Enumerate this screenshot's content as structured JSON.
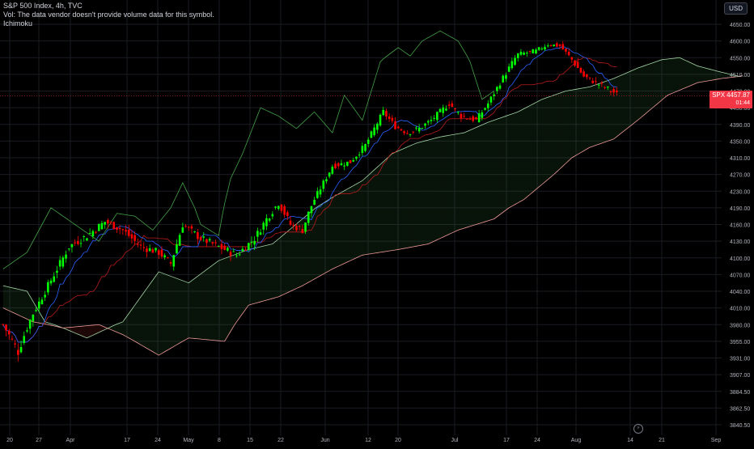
{
  "header": {
    "title": "S&P 500 Index, 4h, TVC",
    "vol_note": "Vol: The data vendor doesn't provide volume data for this symbol.",
    "indicator": "Ichimoku"
  },
  "currency": "USD",
  "price_badge": {
    "symbol": "SPX",
    "value": "4457.87",
    "countdown": "01:44"
  },
  "colors": {
    "background": "#000000",
    "grid": "#1a1c22",
    "up": "#00ff00",
    "down": "#ff0000",
    "conversion_line": "#2962ff",
    "base_line": "#b71c1c",
    "lagging_span": "#43a047",
    "lead_a": "#a5d6a7",
    "lead_b": "#ef9a9a",
    "cloud_bull": "rgba(67,160,71,0.12)",
    "cloud_bear": "rgba(244,67,54,0.12)",
    "price_line": "#f23645",
    "axis_text": "#b2b5be"
  },
  "chart_data": {
    "type": "candlestick",
    "symbol": "S&P 500 Index",
    "interval": "4h",
    "source": "TVC",
    "indicator": "Ichimoku",
    "y_ticks": [
      3840.5,
      3862.5,
      3884.5,
      3907.0,
      3931.0,
      3955.0,
      3980.0,
      4010.0,
      4040.0,
      4070.0,
      4100.0,
      4130.0,
      4160.0,
      4190.0,
      4230.0,
      4270.0,
      4310.0,
      4350.0,
      4390.0,
      4430.0,
      4470.0,
      4510.0,
      4550.0,
      4600.0,
      4650.0
    ],
    "y_tick_labels": [
      "3840.50",
      "3862.50",
      "3884.50",
      "3907.00",
      "3931.00",
      "3955.00",
      "3980.00",
      "4010.00",
      "4040.00",
      "4070.00",
      "4100.00",
      "4130.00",
      "4160.00",
      "4190.00",
      "4230.00",
      "4270.00",
      "4310.00",
      "4350.00",
      "4390.00",
      "4430.00",
      "4470.00",
      "4510.00",
      "4550.00",
      "4600.00",
      "4650.00"
    ],
    "x_ticks": [
      "20",
      "27",
      "Apr",
      "17",
      "24",
      "May",
      "8",
      "15",
      "22",
      "Jun",
      "12",
      "20",
      "Jul",
      "17",
      "24",
      "Aug",
      "14",
      "21",
      "Sep"
    ],
    "last_price": 4457.87,
    "anchors": [
      {
        "i": 0,
        "p": 3980
      },
      {
        "i": 5,
        "p": 3940
      },
      {
        "i": 10,
        "p": 4000
      },
      {
        "i": 16,
        "p": 4060
      },
      {
        "i": 22,
        "p": 4120
      },
      {
        "i": 28,
        "p": 4140
      },
      {
        "i": 34,
        "p": 4165
      },
      {
        "i": 40,
        "p": 4150
      },
      {
        "i": 46,
        "p": 4120
      },
      {
        "i": 52,
        "p": 4110
      },
      {
        "i": 56,
        "p": 4090
      },
      {
        "i": 60,
        "p": 4160
      },
      {
        "i": 66,
        "p": 4135
      },
      {
        "i": 72,
        "p": 4120
      },
      {
        "i": 78,
        "p": 4105
      },
      {
        "i": 84,
        "p": 4135
      },
      {
        "i": 88,
        "p": 4170
      },
      {
        "i": 92,
        "p": 4200
      },
      {
        "i": 96,
        "p": 4160
      },
      {
        "i": 100,
        "p": 4150
      },
      {
        "i": 104,
        "p": 4210
      },
      {
        "i": 110,
        "p": 4290
      },
      {
        "i": 116,
        "p": 4300
      },
      {
        "i": 121,
        "p": 4340
      },
      {
        "i": 127,
        "p": 4420
      },
      {
        "i": 131,
        "p": 4385
      },
      {
        "i": 135,
        "p": 4370
      },
      {
        "i": 139,
        "p": 4380
      },
      {
        "i": 143,
        "p": 4400
      },
      {
        "i": 149,
        "p": 4440
      },
      {
        "i": 153,
        "p": 4410
      },
      {
        "i": 158,
        "p": 4400
      },
      {
        "i": 162,
        "p": 4440
      },
      {
        "i": 166,
        "p": 4490
      },
      {
        "i": 172,
        "p": 4560
      },
      {
        "i": 178,
        "p": 4570
      },
      {
        "i": 182,
        "p": 4590
      },
      {
        "i": 186,
        "p": 4585
      },
      {
        "i": 189,
        "p": 4555
      },
      {
        "i": 194,
        "p": 4505
      },
      {
        "i": 198,
        "p": 4490
      },
      {
        "i": 202,
        "p": 4475
      },
      {
        "i": 206,
        "p": 4458
      }
    ],
    "lag_anchors": [
      {
        "i": 0,
        "p": 4080
      },
      {
        "i": 8,
        "p": 4110
      },
      {
        "i": 16,
        "p": 4190
      },
      {
        "i": 24,
        "p": 4160
      },
      {
        "i": 32,
        "p": 4130
      },
      {
        "i": 38,
        "p": 4180
      },
      {
        "i": 44,
        "p": 4175
      },
      {
        "i": 50,
        "p": 4150
      },
      {
        "i": 56,
        "p": 4190
      },
      {
        "i": 60,
        "p": 4250
      },
      {
        "i": 66,
        "p": 4160
      },
      {
        "i": 72,
        "p": 4140
      },
      {
        "i": 76,
        "p": 4260
      },
      {
        "i": 80,
        "p": 4320
      },
      {
        "i": 86,
        "p": 4430
      },
      {
        "i": 92,
        "p": 4410
      },
      {
        "i": 98,
        "p": 4380
      },
      {
        "i": 104,
        "p": 4420
      },
      {
        "i": 110,
        "p": 4370
      },
      {
        "i": 114,
        "p": 4460
      },
      {
        "i": 120,
        "p": 4400
      },
      {
        "i": 126,
        "p": 4540
      },
      {
        "i": 132,
        "p": 4580
      },
      {
        "i": 136,
        "p": 4555
      },
      {
        "i": 140,
        "p": 4600
      },
      {
        "i": 146,
        "p": 4630
      },
      {
        "i": 152,
        "p": 4600
      },
      {
        "i": 156,
        "p": 4540
      },
      {
        "i": 160,
        "p": 4450
      },
      {
        "i": 164,
        "p": 4470
      }
    ],
    "spanA_anchors": [
      {
        "i": 0,
        "p": 4050
      },
      {
        "i": 8,
        "p": 4040
      },
      {
        "i": 14,
        "p": 3985
      },
      {
        "i": 20,
        "p": 3975
      },
      {
        "i": 28,
        "p": 3960
      },
      {
        "i": 40,
        "p": 3985
      },
      {
        "i": 52,
        "p": 4075
      },
      {
        "i": 62,
        "p": 4055
      },
      {
        "i": 72,
        "p": 4095
      },
      {
        "i": 82,
        "p": 4115
      },
      {
        "i": 90,
        "p": 4125
      },
      {
        "i": 100,
        "p": 4170
      },
      {
        "i": 110,
        "p": 4215
      },
      {
        "i": 120,
        "p": 4255
      },
      {
        "i": 130,
        "p": 4320
      },
      {
        "i": 138,
        "p": 4345
      },
      {
        "i": 146,
        "p": 4360
      },
      {
        "i": 154,
        "p": 4370
      },
      {
        "i": 162,
        "p": 4395
      },
      {
        "i": 172,
        "p": 4420
      },
      {
        "i": 180,
        "p": 4450
      },
      {
        "i": 188,
        "p": 4470
      },
      {
        "i": 196,
        "p": 4480
      },
      {
        "i": 204,
        "p": 4500
      },
      {
        "i": 212,
        "p": 4525
      },
      {
        "i": 220,
        "p": 4545
      },
      {
        "i": 226,
        "p": 4550
      },
      {
        "i": 232,
        "p": 4530
      },
      {
        "i": 240,
        "p": 4515
      },
      {
        "i": 246,
        "p": 4505
      }
    ],
    "spanB_anchors": [
      {
        "i": 0,
        "p": 4010
      },
      {
        "i": 10,
        "p": 3985
      },
      {
        "i": 20,
        "p": 3975
      },
      {
        "i": 32,
        "p": 3980
      },
      {
        "i": 40,
        "p": 3965
      },
      {
        "i": 52,
        "p": 3935
      },
      {
        "i": 62,
        "p": 3960
      },
      {
        "i": 74,
        "p": 3955
      },
      {
        "i": 82,
        "p": 4015
      },
      {
        "i": 92,
        "p": 4030
      },
      {
        "i": 100,
        "p": 4050
      },
      {
        "i": 110,
        "p": 4080
      },
      {
        "i": 120,
        "p": 4105
      },
      {
        "i": 132,
        "p": 4115
      },
      {
        "i": 142,
        "p": 4125
      },
      {
        "i": 152,
        "p": 4150
      },
      {
        "i": 164,
        "p": 4170
      },
      {
        "i": 174,
        "p": 4210
      },
      {
        "i": 184,
        "p": 4270
      },
      {
        "i": 190,
        "p": 4310
      },
      {
        "i": 196,
        "p": 4335
      },
      {
        "i": 204,
        "p": 4355
      },
      {
        "i": 212,
        "p": 4400
      },
      {
        "i": 222,
        "p": 4460
      },
      {
        "i": 232,
        "p": 4490
      },
      {
        "i": 240,
        "p": 4500
      },
      {
        "i": 246,
        "p": 4505
      }
    ]
  }
}
